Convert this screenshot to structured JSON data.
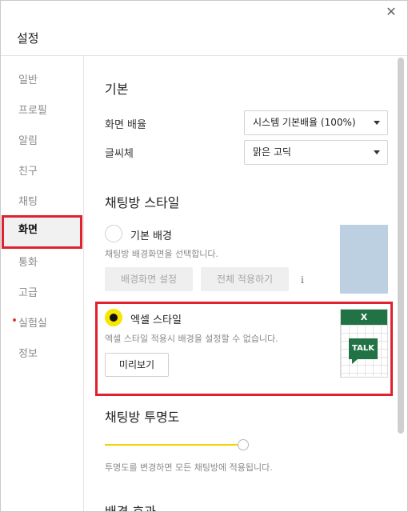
{
  "window": {
    "title": "설정",
    "close_glyph": "✕"
  },
  "sidebar": {
    "items": [
      {
        "label": "일반",
        "active": false,
        "new": false
      },
      {
        "label": "프로필",
        "active": false,
        "new": false
      },
      {
        "label": "알림",
        "active": false,
        "new": false
      },
      {
        "label": "친구",
        "active": false,
        "new": false
      },
      {
        "label": "채팅",
        "active": false,
        "new": false
      },
      {
        "label": "화면",
        "active": true,
        "new": false
      },
      {
        "label": "통화",
        "active": false,
        "new": false
      },
      {
        "label": "고급",
        "active": false,
        "new": false
      },
      {
        "label": "실험실",
        "active": false,
        "new": true
      },
      {
        "label": "정보",
        "active": false,
        "new": false
      }
    ]
  },
  "basic": {
    "title": "기본",
    "zoom_label": "화면 배율",
    "zoom_value": "시스템 기본배율 (100%)",
    "font_label": "글씨체",
    "font_value": "맑은 고딕"
  },
  "style": {
    "title": "채팅방 스타일",
    "default_bg": {
      "label": "기본 배경",
      "desc": "채팅방 배경화면을 선택합니다.",
      "set_button": "배경화면 설정",
      "apply_all_button": "전체 적용하기",
      "info_glyph": "i",
      "checked": false
    },
    "excel": {
      "label": "엑셀 스타일",
      "desc": "엑셀 스타일 적용시 배경을 설정할 수 없습니다.",
      "preview_button": "미리보기",
      "checked": true,
      "thumb_header": "X",
      "thumb_talk": "TALK"
    }
  },
  "opacity": {
    "title": "채팅방 투명도",
    "desc": "투명도를 변경하면 모든 채팅방에 적용됩니다.",
    "level": 1.0
  },
  "effect": {
    "title": "배경 효과"
  },
  "colors": {
    "accent_yellow": "#f7e600",
    "slider_yellow": "#f0d200",
    "highlight_red": "#e0212e",
    "excel_green": "#217346",
    "preview_blue": "#bdd0e2"
  }
}
